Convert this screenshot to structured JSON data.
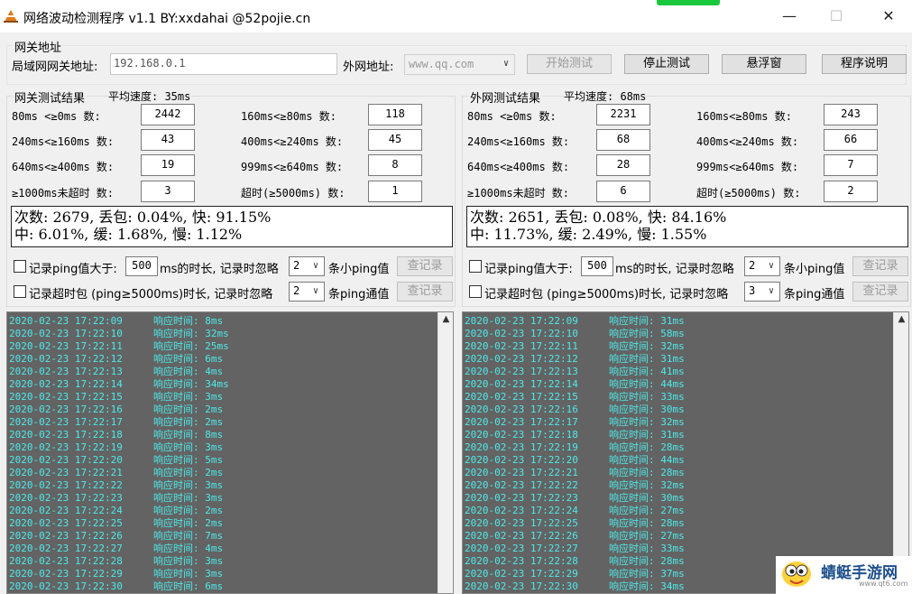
{
  "window": {
    "title": "网络波动检测程序 v1.1  BY:xxdahai  @52pojie.cn",
    "minimize_glyph": "—",
    "maximize_glyph": "☐",
    "close_glyph": "✕",
    "icon_name": "app-cone-icon",
    "accent_color": "#19c83c"
  },
  "gateway": {
    "group_label": "网关地址",
    "lan_label": "局域网网关地址:",
    "lan_value": "192.168.0.1",
    "wan_label": "外网地址:",
    "wan_value": "www.qq.com",
    "buttons": {
      "start": "开始测试",
      "stop": "停止测试",
      "float": "悬浮窗",
      "help": "程序说明"
    }
  },
  "left": {
    "title": "网关测试结果",
    "avg": "平均速度: 35ms",
    "stats": [
      {
        "label": "80ms <≥0ms  数:",
        "value": "2442"
      },
      {
        "label": "160ms<≥80ms  数:",
        "value": "118"
      },
      {
        "label": "240ms<≥160ms 数:",
        "value": "43"
      },
      {
        "label": "400ms<≥240ms 数:",
        "value": "45"
      },
      {
        "label": "640ms<≥400ms 数:",
        "value": "19"
      },
      {
        "label": "999ms<≥640ms 数:",
        "value": "8"
      },
      {
        "label": "≥1000ms未超时 数:",
        "value": "3"
      },
      {
        "label": "超时(≥5000ms) 数:",
        "value": "1"
      }
    ],
    "summary1": "次数: 2679, 丢包: 0.04%, 快: 91.15%",
    "summary2": "中: 6.01%, 缓: 1.68%, 慢: 1.12%",
    "opt1_a": "记录ping值大于:",
    "opt1_val": "500",
    "opt1_b": "ms的时长, 记录时忽略",
    "opt1_n": "2",
    "opt1_c": "条小ping值",
    "opt2_a": "记录超时包 (ping≥5000ms)时长, 记录时忽略",
    "opt2_n": "2",
    "opt2_c": "条ping通值",
    "view_btn": "查记录",
    "log": [
      [
        "2020-02-23 17:22:09",
        "响应时间: 8ms"
      ],
      [
        "2020-02-23 17:22:10",
        "响应时间: 32ms"
      ],
      [
        "2020-02-23 17:22:11",
        "响应时间: 25ms"
      ],
      [
        "2020-02-23 17:22:12",
        "响应时间: 6ms"
      ],
      [
        "2020-02-23 17:22:13",
        "响应时间: 4ms"
      ],
      [
        "2020-02-23 17:22:14",
        "响应时间: 34ms"
      ],
      [
        "2020-02-23 17:22:15",
        "响应时间: 3ms"
      ],
      [
        "2020-02-23 17:22:16",
        "响应时间: 2ms"
      ],
      [
        "2020-02-23 17:22:17",
        "响应时间: 2ms"
      ],
      [
        "2020-02-23 17:22:18",
        "响应时间: 8ms"
      ],
      [
        "2020-02-23 17:22:19",
        "响应时间: 3ms"
      ],
      [
        "2020-02-23 17:22:20",
        "响应时间: 5ms"
      ],
      [
        "2020-02-23 17:22:21",
        "响应时间: 2ms"
      ],
      [
        "2020-02-23 17:22:22",
        "响应时间: 3ms"
      ],
      [
        "2020-02-23 17:22:23",
        "响应时间: 3ms"
      ],
      [
        "2020-02-23 17:22:24",
        "响应时间: 2ms"
      ],
      [
        "2020-02-23 17:22:25",
        "响应时间: 2ms"
      ],
      [
        "2020-02-23 17:22:26",
        "响应时间: 7ms"
      ],
      [
        "2020-02-23 17:22:27",
        "响应时间: 4ms"
      ],
      [
        "2020-02-23 17:22:28",
        "响应时间: 3ms"
      ],
      [
        "2020-02-23 17:22:29",
        "响应时间: 3ms"
      ],
      [
        "2020-02-23 17:22:30",
        "响应时间: 6ms"
      ]
    ]
  },
  "right": {
    "title": "外网测试结果",
    "avg": "平均速度: 68ms",
    "stats": [
      {
        "label": "80ms <≥0ms  数:",
        "value": "2231"
      },
      {
        "label": "160ms<≥80ms  数:",
        "value": "243"
      },
      {
        "label": "240ms<≥160ms 数:",
        "value": "68"
      },
      {
        "label": "400ms<≥240ms 数:",
        "value": "66"
      },
      {
        "label": "640ms<≥400ms 数:",
        "value": "28"
      },
      {
        "label": "999ms<≥640ms 数:",
        "value": "7"
      },
      {
        "label": "≥1000ms未超时 数:",
        "value": "6"
      },
      {
        "label": "超时(≥5000ms) 数:",
        "value": "2"
      }
    ],
    "summary1": "次数: 2651, 丢包: 0.08%, 快: 84.16%",
    "summary2": "中: 11.73%, 缓: 2.49%, 慢: 1.55%",
    "opt1_a": "记录ping值大于:",
    "opt1_val": "500",
    "opt1_b": "ms的时长, 记录时忽略",
    "opt1_n": "2",
    "opt1_c": "条小ping值",
    "opt2_a": "记录超时包 (ping≥5000ms)时长, 记录时忽略",
    "opt2_n": "3",
    "opt2_c": "条ping通值",
    "view_btn": "查记录",
    "log": [
      [
        "2020-02-23 17:22:09",
        "响应时间: 31ms"
      ],
      [
        "2020-02-23 17:22:10",
        "响应时间: 58ms"
      ],
      [
        "2020-02-23 17:22:11",
        "响应时间: 32ms"
      ],
      [
        "2020-02-23 17:22:12",
        "响应时间: 31ms"
      ],
      [
        "2020-02-23 17:22:13",
        "响应时间: 41ms"
      ],
      [
        "2020-02-23 17:22:14",
        "响应时间: 44ms"
      ],
      [
        "2020-02-23 17:22:15",
        "响应时间: 33ms"
      ],
      [
        "2020-02-23 17:22:16",
        "响应时间: 30ms"
      ],
      [
        "2020-02-23 17:22:17",
        "响应时间: 32ms"
      ],
      [
        "2020-02-23 17:22:18",
        "响应时间: 31ms"
      ],
      [
        "2020-02-23 17:22:19",
        "响应时间: 28ms"
      ],
      [
        "2020-02-23 17:22:20",
        "响应时间: 44ms"
      ],
      [
        "2020-02-23 17:22:21",
        "响应时间: 28ms"
      ],
      [
        "2020-02-23 17:22:22",
        "响应时间: 32ms"
      ],
      [
        "2020-02-23 17:22:23",
        "响应时间: 30ms"
      ],
      [
        "2020-02-23 17:22:24",
        "响应时间: 27ms"
      ],
      [
        "2020-02-23 17:22:25",
        "响应时间: 28ms"
      ],
      [
        "2020-02-23 17:22:26",
        "响应时间: 27ms"
      ],
      [
        "2020-02-23 17:22:27",
        "响应时间: 33ms"
      ],
      [
        "2020-02-23 17:22:28",
        "响应时间: 28ms"
      ],
      [
        "2020-02-23 17:22:29",
        "响应时间: 37ms"
      ],
      [
        "2020-02-23 17:22:30",
        "响应时间: 34ms"
      ]
    ]
  },
  "watermark": {
    "text": "蜻蜓手游网",
    "sub": "www.qt6.com",
    "icon_name": "dragonfly-logo-icon"
  }
}
